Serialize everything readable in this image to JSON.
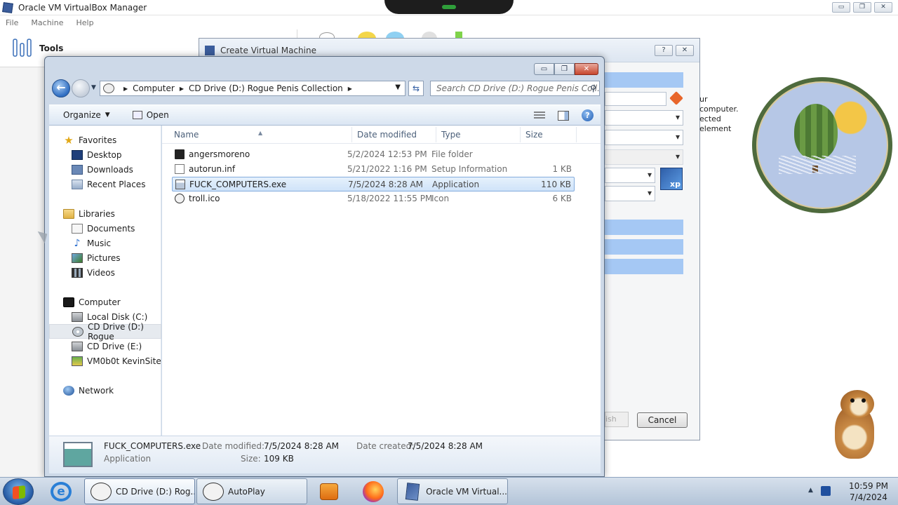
{
  "vbox": {
    "title": "Oracle VM VirtualBox Manager",
    "menu": [
      "File",
      "Machine",
      "Help"
    ],
    "tools_label": "Tools",
    "window_buttons": [
      "▭",
      "❐",
      "✕"
    ]
  },
  "wizard": {
    "title": "Create Virtual Machine",
    "note_line1": "ur computer.",
    "note_line2": "ected element",
    "os_badge": "xp",
    "finish_label": "ish",
    "cancel_label": "Cancel",
    "help_btn": "?",
    "close_btn": "✕"
  },
  "dialog": {
    "window_buttons": [
      "▭",
      "❐",
      "✕"
    ],
    "breadcrumb": [
      "Computer",
      "CD Drive (D:) Rogue Penis Collection"
    ],
    "search_placeholder": "Search CD Drive (D:) Rogue Penis Coll...",
    "organize_label": "Organize",
    "open_label": "Open",
    "help_label": "?",
    "nav": {
      "favorites": {
        "label": "Favorites",
        "items": [
          "Desktop",
          "Downloads",
          "Recent Places"
        ]
      },
      "libraries": {
        "label": "Libraries",
        "items": [
          "Documents",
          "Music",
          "Pictures",
          "Videos"
        ]
      },
      "computer": {
        "label": "Computer",
        "items": [
          "Local Disk (C:)",
          "CD Drive (D:) Rogue",
          "CD Drive (E:)",
          "VM0b0t KevinSite"
        ]
      },
      "network": {
        "label": "Network"
      }
    },
    "columns": {
      "name": "Name",
      "date": "Date modified",
      "type": "Type",
      "size": "Size"
    },
    "files": [
      {
        "name": "angersmoreno",
        "date": "5/2/2024 12:53 PM",
        "type": "File folder",
        "size": "",
        "icon": "folder-icon"
      },
      {
        "name": "autorun.inf",
        "date": "5/21/2022 1:16 PM",
        "type": "Setup Information",
        "size": "1 KB",
        "icon": "setup-file-icon"
      },
      {
        "name": "FUCK_COMPUTERS.exe",
        "date": "7/5/2024 8:28 AM",
        "type": "Application",
        "size": "110 KB",
        "icon": "application-icon"
      },
      {
        "name": "troll.ico",
        "date": "5/18/2022 11:55 PM",
        "type": "Icon",
        "size": "6 KB",
        "icon": "troll-face-icon"
      }
    ],
    "details": {
      "name": "FUCK_COMPUTERS.exe",
      "type": "Application",
      "modified_label": "Date modified:",
      "modified_value": "7/5/2024 8:28 AM",
      "size_label": "Size:",
      "size_value": "109 KB",
      "created_label": "Date created:",
      "created_value": "7/5/2024 8:28 AM"
    }
  },
  "taskbar": {
    "buttons": [
      "CD Drive (D:) Rog...",
      "AutoPlay",
      "Oracle VM Virtual..."
    ],
    "time": "10:59 PM",
    "date": "7/4/2024"
  },
  "colors": {
    "selection": "#cfe3f9",
    "wizard_highlight": "#a5c8f4",
    "taskbar": "#c3d1e2"
  }
}
